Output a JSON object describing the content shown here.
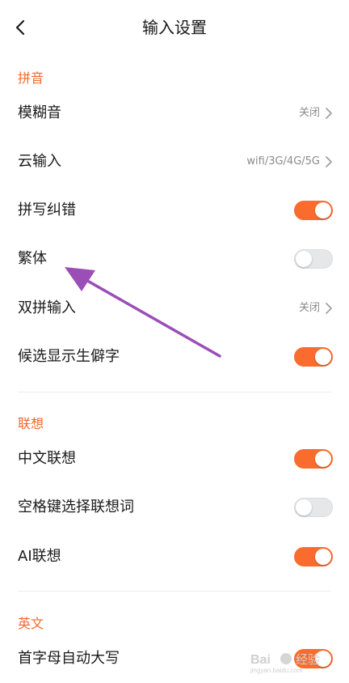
{
  "header": {
    "title": "输入设置",
    "back_icon": "chevron-left-icon"
  },
  "sections": [
    {
      "title": "拼音",
      "items": [
        {
          "label": "模糊音",
          "value": "关闭",
          "control": "chevron"
        },
        {
          "label": "云输入",
          "value": "wifi/3G/4G/5G",
          "control": "chevron"
        },
        {
          "label": "拼写纠错",
          "control": "toggle",
          "state": "on"
        },
        {
          "label": "繁体",
          "control": "toggle",
          "state": "off"
        },
        {
          "label": "双拼输入",
          "value": "关闭",
          "control": "chevron"
        },
        {
          "label": "候选显示生僻字",
          "control": "toggle",
          "state": "on"
        }
      ]
    },
    {
      "title": "联想",
      "items": [
        {
          "label": "中文联想",
          "control": "toggle",
          "state": "on"
        },
        {
          "label": "空格键选择联想词",
          "control": "toggle",
          "state": "off"
        },
        {
          "label": "AI联想",
          "control": "toggle",
          "state": "on"
        }
      ]
    },
    {
      "title": "英文",
      "items": [
        {
          "label": "首字母自动大写",
          "control": "toggle",
          "state": "on"
        }
      ]
    }
  ],
  "colors": {
    "accent": "#f06a2b",
    "toggle_on": "#f96c2e",
    "toggle_off": "#e6e7e9",
    "annotation_arrow": "#9b4fb6"
  },
  "watermark": {
    "text": "Bai 经验",
    "subtext": "jingyan.baidu.com"
  }
}
